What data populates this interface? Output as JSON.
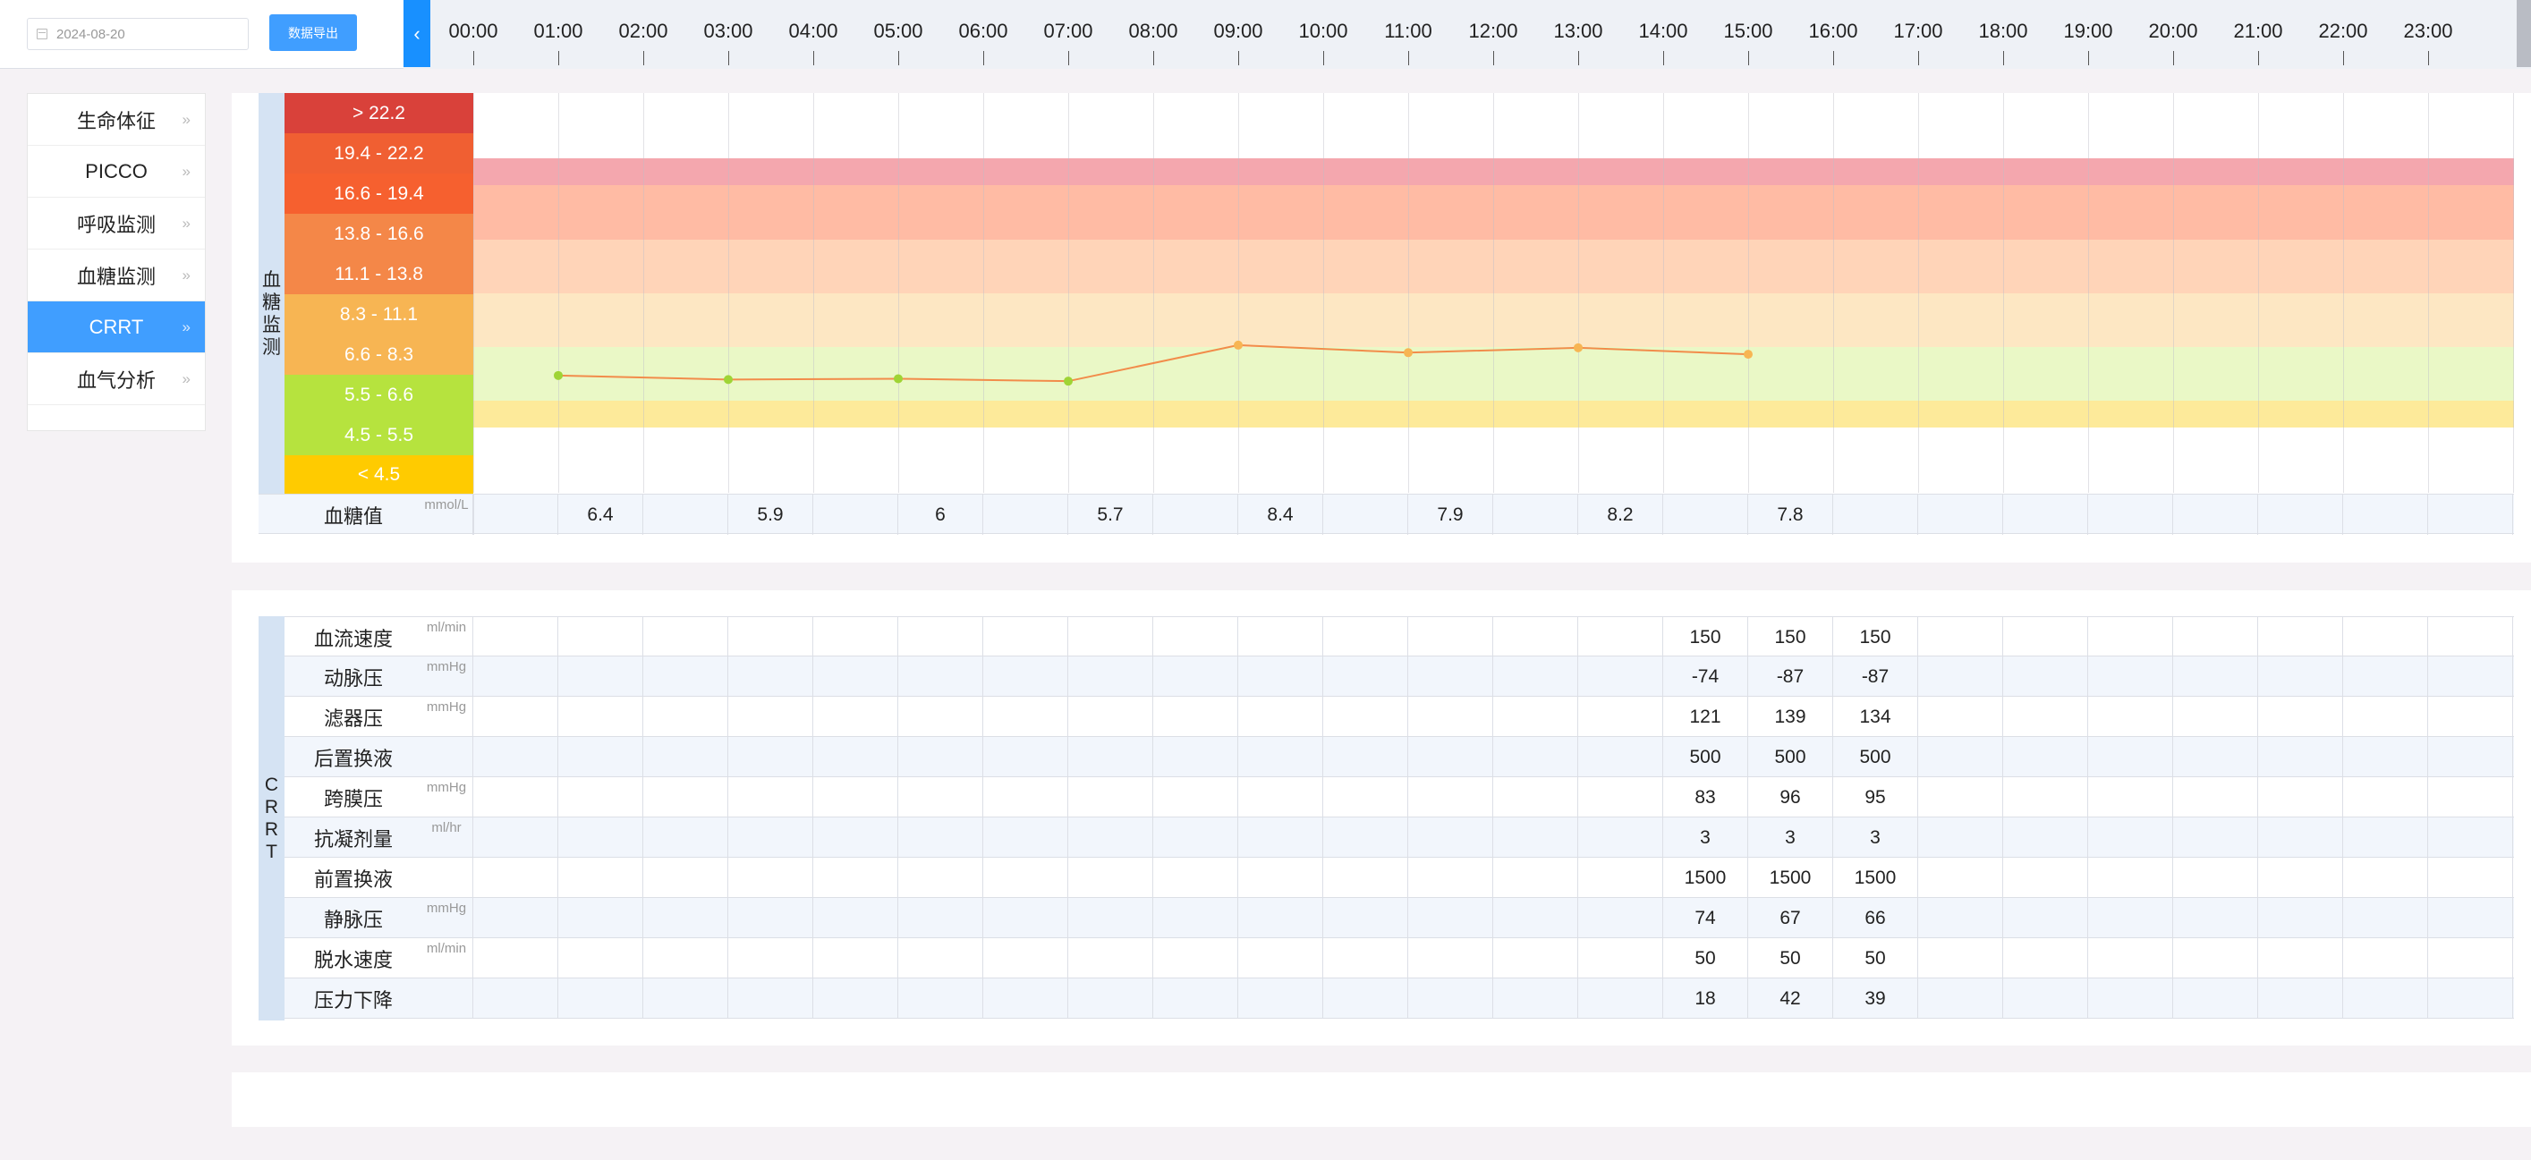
{
  "toolbar": {
    "date_value": "2024-08-20",
    "export_label": "数据导出"
  },
  "timeline": {
    "prev_symbol": "‹",
    "hours": [
      "00:00",
      "01:00",
      "02:00",
      "03:00",
      "04:00",
      "05:00",
      "06:00",
      "07:00",
      "08:00",
      "09:00",
      "10:00",
      "11:00",
      "12:00",
      "13:00",
      "14:00",
      "15:00",
      "16:00",
      "17:00",
      "18:00",
      "19:00",
      "20:00",
      "21:00",
      "22:00",
      "23:00"
    ]
  },
  "sidebar": {
    "items": [
      {
        "label": "生命体征",
        "chevron": "»"
      },
      {
        "label": "PICCO",
        "chevron": "»"
      },
      {
        "label": "呼吸监测",
        "chevron": "»"
      },
      {
        "label": "血糖监测",
        "chevron": "»"
      },
      {
        "label": "CRRT",
        "chevron": "»",
        "active": true
      },
      {
        "label": "血气分析",
        "chevron": "»"
      }
    ]
  },
  "glucose": {
    "section_label": "血糖监测",
    "ranges": [
      {
        "label": "> 22.2",
        "color": "#d9413a"
      },
      {
        "label": "19.4 - 22.2",
        "color": "#f05f32"
      },
      {
        "label": "16.6 - 19.4",
        "color": "#f6602f"
      },
      {
        "label": "13.8 - 16.6",
        "color": "#f48748"
      },
      {
        "label": "11.1 - 13.8",
        "color": "#f48748"
      },
      {
        "label": "8.3 - 11.1",
        "color": "#f7b553"
      },
      {
        "label": "6.6 - 8.3",
        "color": "#f7b553"
      },
      {
        "label": "5.5 - 6.6",
        "color": "#b6e33e"
      },
      {
        "label": "4.5 - 5.5",
        "color": "#b6e33e"
      },
      {
        "label": "< 4.5",
        "color": "#ffcb00"
      }
    ],
    "bands": [
      {
        "color": "#f4a7ae"
      },
      {
        "color": "#ffbba4"
      },
      {
        "color": "#ffd4b8"
      },
      {
        "color": "#fde7c3"
      },
      {
        "color": "#eaf8c6"
      },
      {
        "color": "#fdea9a"
      }
    ],
    "line_color": "#f28c4a",
    "value_row": {
      "label": "血糖值",
      "unit": "mmol/L",
      "cells": [
        "",
        "6.4",
        "",
        "5.9",
        "",
        "6",
        "",
        "5.7",
        "",
        "8.4",
        "",
        "7.9",
        "",
        "8.2",
        "",
        "7.8",
        "",
        "",
        "",
        "",
        "",
        "",
        "",
        ""
      ]
    },
    "points": [
      {
        "hour": 1,
        "value": 6.4,
        "color": "#9fd435"
      },
      {
        "hour": 3,
        "value": 5.9,
        "color": "#9fd435"
      },
      {
        "hour": 5,
        "value": 6,
        "color": "#9fd435"
      },
      {
        "hour": 7,
        "value": 5.7,
        "color": "#9fd435"
      },
      {
        "hour": 9,
        "value": 8.4,
        "color": "#f7b553"
      },
      {
        "hour": 11,
        "value": 7.9,
        "color": "#f7b553"
      },
      {
        "hour": 13,
        "value": 8.2,
        "color": "#f7b553"
      },
      {
        "hour": 15,
        "value": 7.8,
        "color": "#f7b553"
      }
    ]
  },
  "crrt": {
    "section_label": "CRRT",
    "rows": [
      {
        "label": "血流速度",
        "unit": "ml/min",
        "values": {
          "14": "150",
          "15": "150",
          "16": "150"
        }
      },
      {
        "label": "动脉压",
        "unit": "mmHg",
        "values": {
          "14": "-74",
          "15": "-87",
          "16": "-87"
        }
      },
      {
        "label": "滤器压",
        "unit": "mmHg",
        "values": {
          "14": "121",
          "15": "139",
          "16": "134"
        }
      },
      {
        "label": "后置换液",
        "unit": "",
        "values": {
          "14": "500",
          "15": "500",
          "16": "500"
        }
      },
      {
        "label": "跨膜压",
        "unit": "mmHg",
        "values": {
          "14": "83",
          "15": "96",
          "16": "95"
        }
      },
      {
        "label": "抗凝剂量",
        "unit": "ml/hr",
        "values": {
          "14": "3",
          "15": "3",
          "16": "3"
        }
      },
      {
        "label": "前置换液",
        "unit": "",
        "values": {
          "14": "1500",
          "15": "1500",
          "16": "1500"
        }
      },
      {
        "label": "静脉压",
        "unit": "mmHg",
        "values": {
          "14": "74",
          "15": "67",
          "16": "66"
        }
      },
      {
        "label": "脱水速度",
        "unit": "ml/min",
        "values": {
          "14": "50",
          "15": "50",
          "16": "50"
        }
      },
      {
        "label": "压力下降",
        "unit": "",
        "values": {
          "14": "18",
          "15": "42",
          "16": "39"
        }
      }
    ]
  }
}
